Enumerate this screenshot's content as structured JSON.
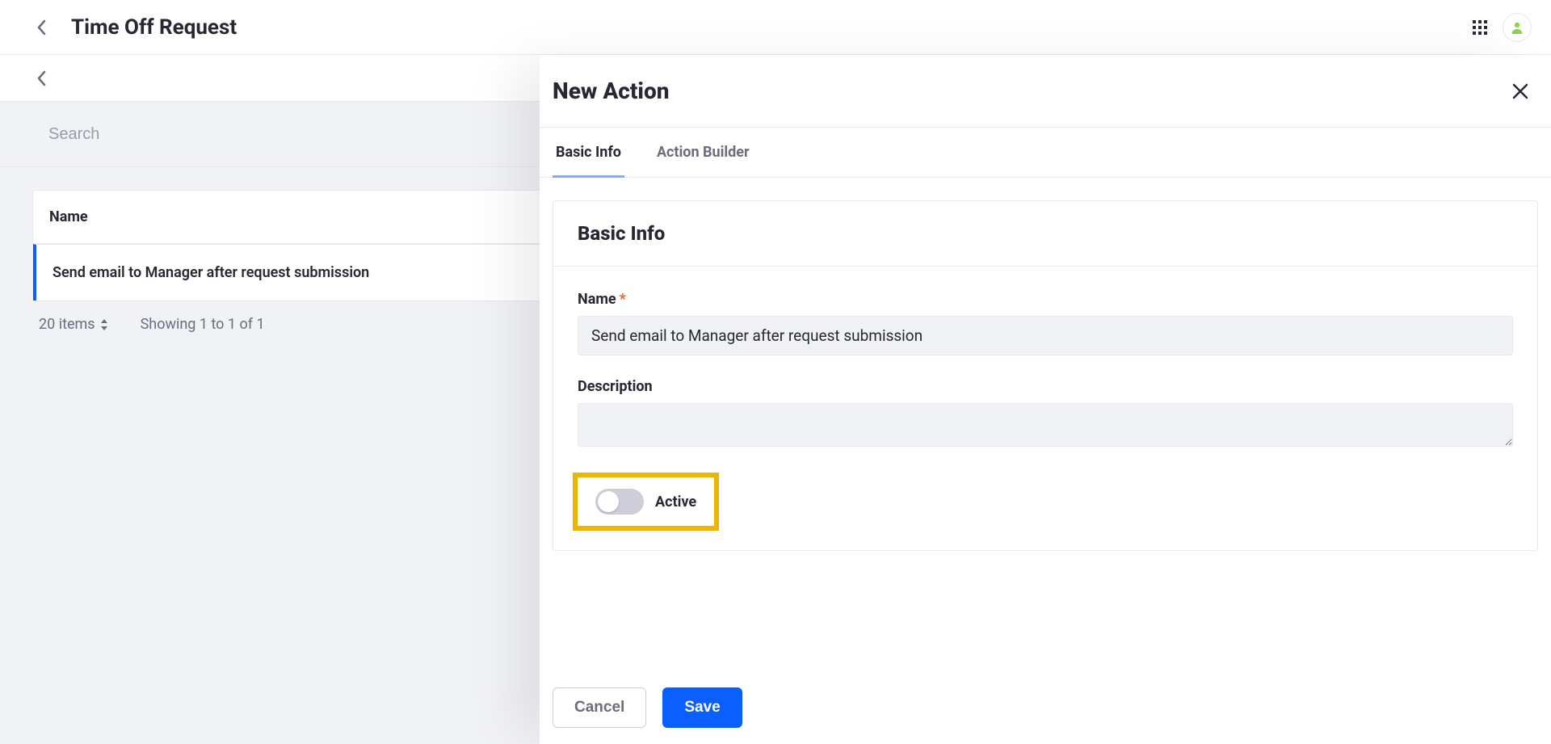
{
  "header": {
    "title": "Time Off Request"
  },
  "search": {
    "placeholder": "Search",
    "value": ""
  },
  "list": {
    "column_header": "Name",
    "rows": [
      {
        "name": "Send email to Manager after request submission"
      }
    ],
    "footer": {
      "items_label": "20 items",
      "range_label": "Showing 1 to 1 of 1"
    }
  },
  "panel": {
    "title": "New Action",
    "tabs": [
      {
        "label": "Basic Info",
        "active": true
      },
      {
        "label": "Action Builder",
        "active": false
      }
    ],
    "form": {
      "section_title": "Basic Info",
      "name_label": "Name",
      "name_value": "Send email to Manager after request submission",
      "description_label": "Description",
      "description_value": "",
      "active_label": "Active",
      "active_on": false
    },
    "buttons": {
      "cancel": "Cancel",
      "save": "Save"
    }
  }
}
